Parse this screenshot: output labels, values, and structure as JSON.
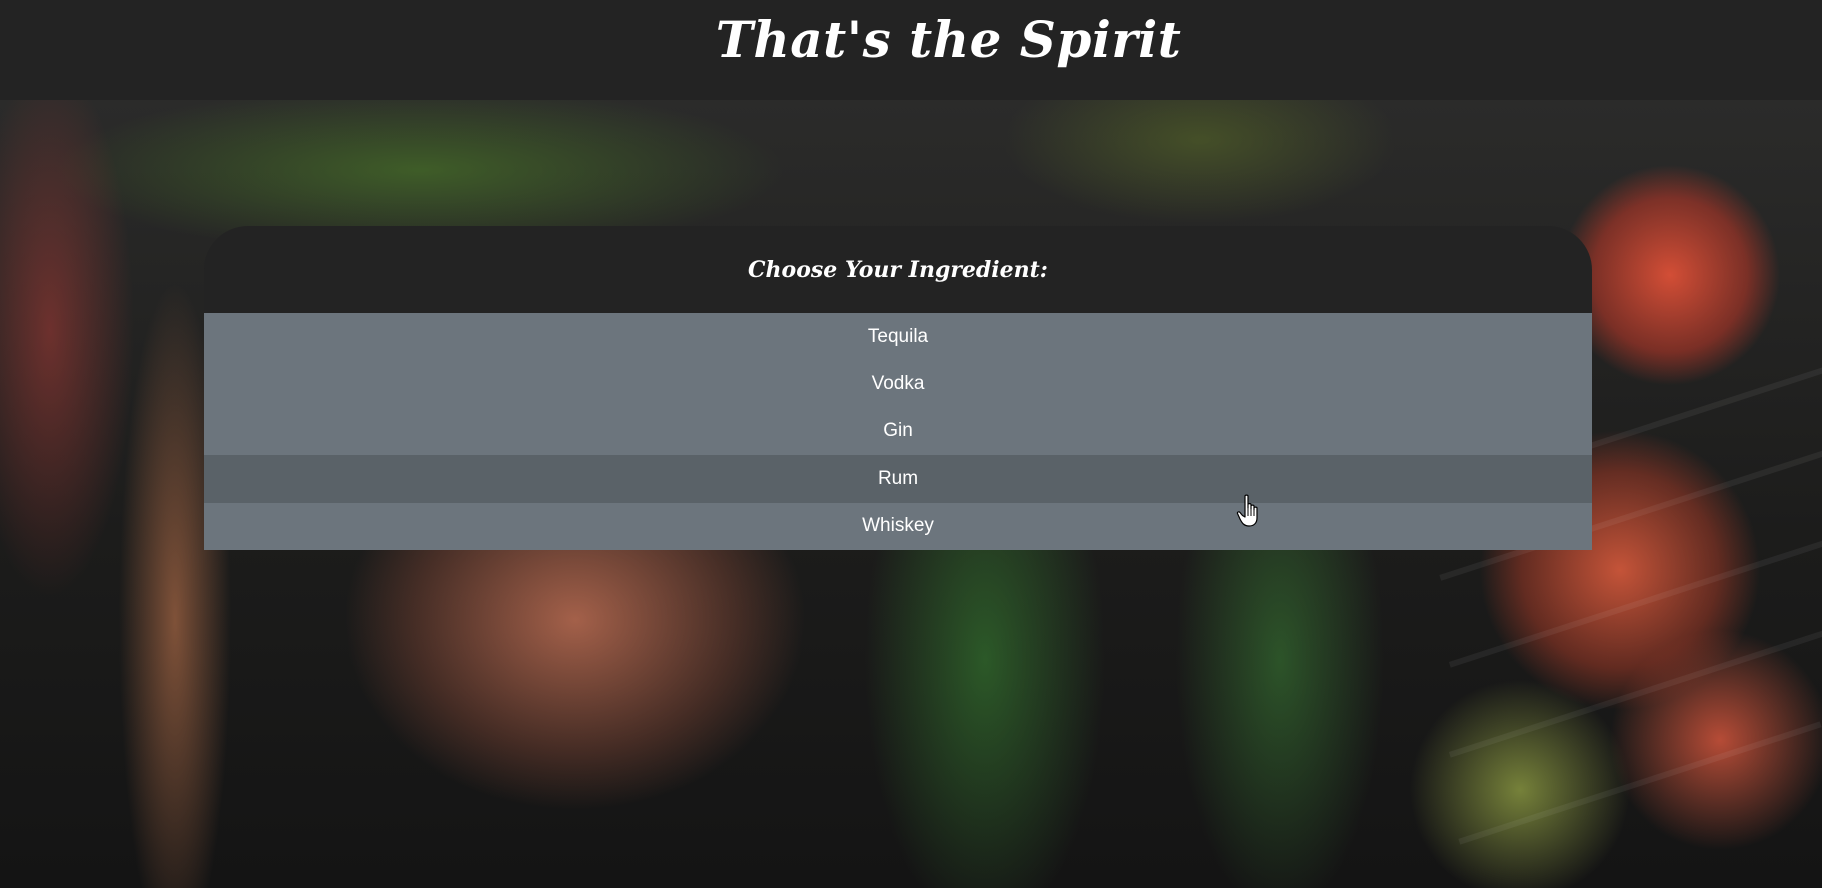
{
  "header": {
    "title": "That's the Spirit"
  },
  "picker": {
    "title": "Choose Your Ingredient:",
    "items": [
      {
        "label": "Tequila"
      },
      {
        "label": "Vodka"
      },
      {
        "label": "Gin"
      },
      {
        "label": "Rum"
      },
      {
        "label": "Whiskey"
      }
    ],
    "hovered_item": "Rum"
  },
  "colors": {
    "header_bg": "#232323",
    "list_bg": "#6c757d",
    "list_hover_bg": "#5a6268",
    "text": "#ffffff"
  },
  "icons": {
    "cursor": "hand-pointer-icon"
  }
}
